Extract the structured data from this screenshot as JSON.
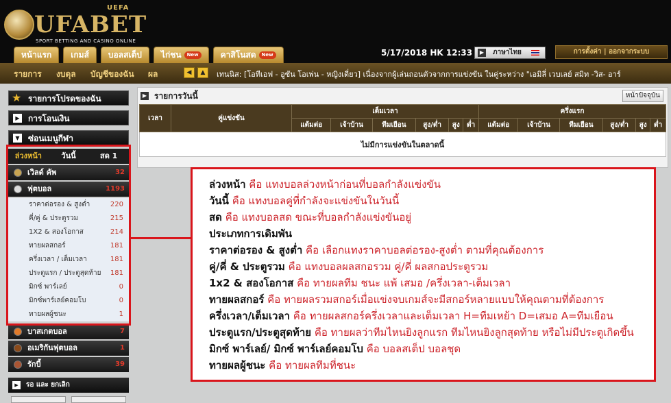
{
  "brand": {
    "name": "UFABET",
    "uefa": "UEFA",
    "tagline": "SPORT BETTING AND CASINO ONLINE"
  },
  "nav": {
    "tabs": [
      {
        "label": "หน้าแรก"
      },
      {
        "label": "เกมส์"
      },
      {
        "label": "บอลสเต็ป"
      },
      {
        "label": "ไก่ชน",
        "badge": "New"
      },
      {
        "label": "คาสิโนสด",
        "badge": "New"
      }
    ],
    "datetime": "5/17/2018 HK 12:33 PM",
    "language": "ภาษาไทย",
    "settings": "การตั้งค่า",
    "logout": "ออกจากระบบ",
    "separator": "|"
  },
  "subnav": {
    "items": [
      "รายการ",
      "งบดุล",
      "บัญชีของฉัน",
      "ผล"
    ],
    "ticker": "เทนนิส: [โอทีเอฟ - อูซัน โอเพ่น - หญิงเดี่ยว] เนื่องจากผู้เล่นถอนตัวจากการแข่งขัน ในคู่ระหว่าง \"เอมิลี่ เวบเลย์ สมิท -วิส- อาร์"
  },
  "sidebar": {
    "favorites": "รายการโปรดของฉัน",
    "finance": "การโอนเงิน",
    "hide_menu": "ซ่อนเมนูกีฬา",
    "odds_tabs": [
      "ล่วงหน้า",
      "วันนี้",
      "สด 1"
    ],
    "sports": [
      {
        "name": "เวิลด์ คัพ",
        "count": "32"
      },
      {
        "name": "ฟุตบอล",
        "count": "1193"
      }
    ],
    "football_markets": [
      {
        "label": "ราคาต่อรอง & สูงต่ำ",
        "count": "220"
      },
      {
        "label": "คี่/คู่ & ประตูรวม",
        "count": "215"
      },
      {
        "label": "1X2 & สองโอกาส",
        "count": "214"
      },
      {
        "label": "ทายผลสกอร์",
        "count": "181"
      },
      {
        "label": "ครึ่งเวลา / เต็มเวลา",
        "count": "181"
      },
      {
        "label": "ประตูแรก / ประตูสุดท้าย",
        "count": "181"
      },
      {
        "label": "มิกซ์ พาร์เลย์",
        "count": "0"
      },
      {
        "label": "มิกซ์พาร์เลย์คอมโบ",
        "count": "0"
      },
      {
        "label": "ทายผลผู้ชนะ",
        "count": "1"
      }
    ],
    "more_sports": [
      {
        "name": "บาสเกตบอล",
        "count": "7"
      },
      {
        "name": "อเมริกันฟุตบอล",
        "count": "1"
      },
      {
        "name": "รักบี้",
        "count": "39"
      }
    ],
    "bottom_section": "รอ และ ยกเลิก"
  },
  "main": {
    "title": "รายการวันนี้",
    "refresh": "หน้าปัจจุบัน",
    "columns": {
      "time": "เวลา",
      "match": "คู่แข่งขัน",
      "fulltime": "เต็มเวลา",
      "halftime": "ครึ่งแรก",
      "sub": [
        "แต้มต่อ",
        "เจ้าบ้าน",
        "ทีมเยือน",
        "สูง/ต่ำ",
        "สูง",
        "ต่ำ"
      ]
    },
    "empty": "ไม่มีการแข่งขันในตลาดนี้"
  },
  "explain": [
    {
      "term": "ล่วงหน้า",
      "desc": "คือ แทงบอลล่วงหน้าก่อนที่บอลกำลังแข่งขัน"
    },
    {
      "term": "วันนี้",
      "desc": "คือ แทงบอลคู่ที่กำลังจะแข่งขันในวันนี้"
    },
    {
      "term": "สด",
      "desc": "คือ แทงบอลสด ขณะที่บอลกำลังแข่งขันอยู่"
    },
    {
      "term": "ประเภทการเดิมพัน",
      "desc": ""
    },
    {
      "term": "ราคาต่อรอง & สูงต่ำ",
      "desc": "คือ เลือกแทงราคาบอลต่อรอง-สูงต่ำ ตามที่คุณต้องการ"
    },
    {
      "term": "คู่/คี่ & ประตูรวม",
      "desc": "คือ แทงบอลผลสกอรวม คู่/คี่ ผลสกอประตูรวม"
    },
    {
      "term": "1x2 & สองโอกาส",
      "desc": "คือ ทายผลทีม ชนะ แพ้ เสมอ /ครึ่งเวลา-เต็มเวลา"
    },
    {
      "term": "ทายผลสกอร์",
      "desc": "คือ ทายผลรวมสกอร์เมื่อแข่งจบเกมส์จะมีสกอร์หลายแบบให้คุณตามที่ต้องการ"
    },
    {
      "term": "ครึ่งเวลา/เต็มเวลา",
      "desc": "คือ ทายผลสกอร์ครึ่งเวลาและเต็มเวลา H=ทีมเหย้า D=เสมอ A=ทีมเยือน"
    },
    {
      "term": "ประตูแรก/ประตูสุดท้าย",
      "desc": "คือ ทายผลว่าทีมไหนยิงลูกแรก ทีมไหนยิงลูกสุดท้าย หรือไม่มีประตูเกิดขึ้น"
    },
    {
      "term": "มิกซ์ พาร์เลย์/ มิกซ์ พาร์เลย์คอมโบ",
      "desc": "คือ บอลสเต็ป บอลชุด"
    },
    {
      "term": "ทายผลผู้ชนะ",
      "desc": "คือ ทายผลทีมที่ชนะ"
    }
  ]
}
